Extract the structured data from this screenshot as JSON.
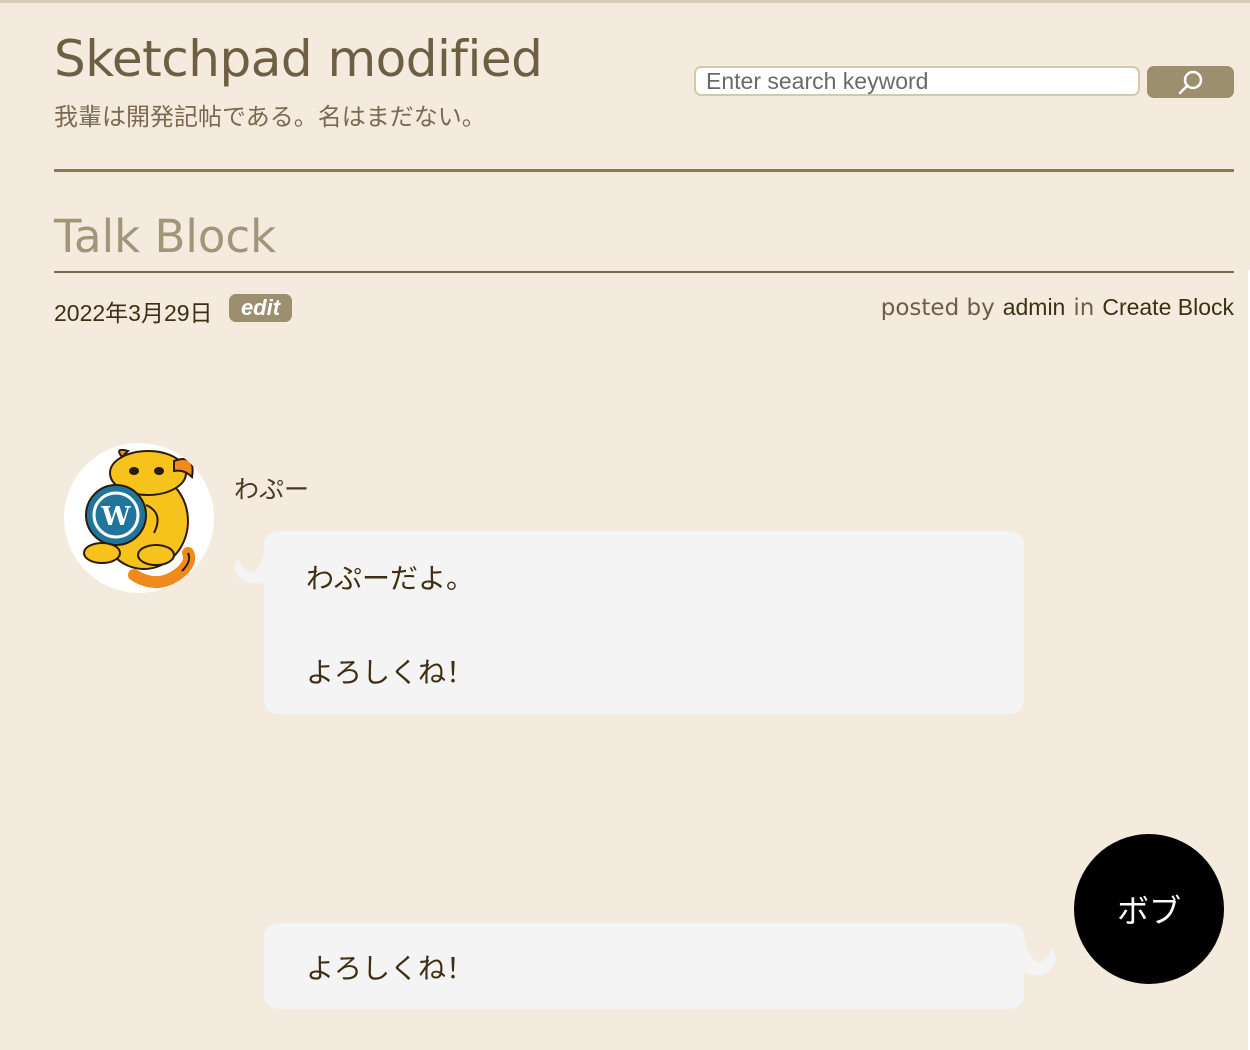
{
  "site": {
    "title": "Sketchpad modified",
    "tagline": "我輩は開発記帖である。名はまだない。"
  },
  "search": {
    "placeholder": "Enter search keyword",
    "button_icon": "search-icon"
  },
  "post": {
    "title": "Talk Block",
    "date": "2022年3月29日",
    "edit_label": "edit",
    "posted_by_label": "posted by",
    "author": "admin",
    "in_label": "in",
    "category": "Create Block"
  },
  "talk": [
    {
      "speaker": "わぷー",
      "avatar_icon": "wapuu-avatar",
      "side": "left",
      "lines": [
        "わぷーだよ。",
        "よろしくね！"
      ]
    },
    {
      "speaker": "ボブ",
      "avatar_icon": "text-avatar",
      "side": "right",
      "lines": [
        "よろしくね！"
      ]
    }
  ],
  "colors": {
    "background": "#f4eadd",
    "accent": "#9b8f6e",
    "rule": "#8a7a5c",
    "bubble": "#f4f4f4"
  }
}
